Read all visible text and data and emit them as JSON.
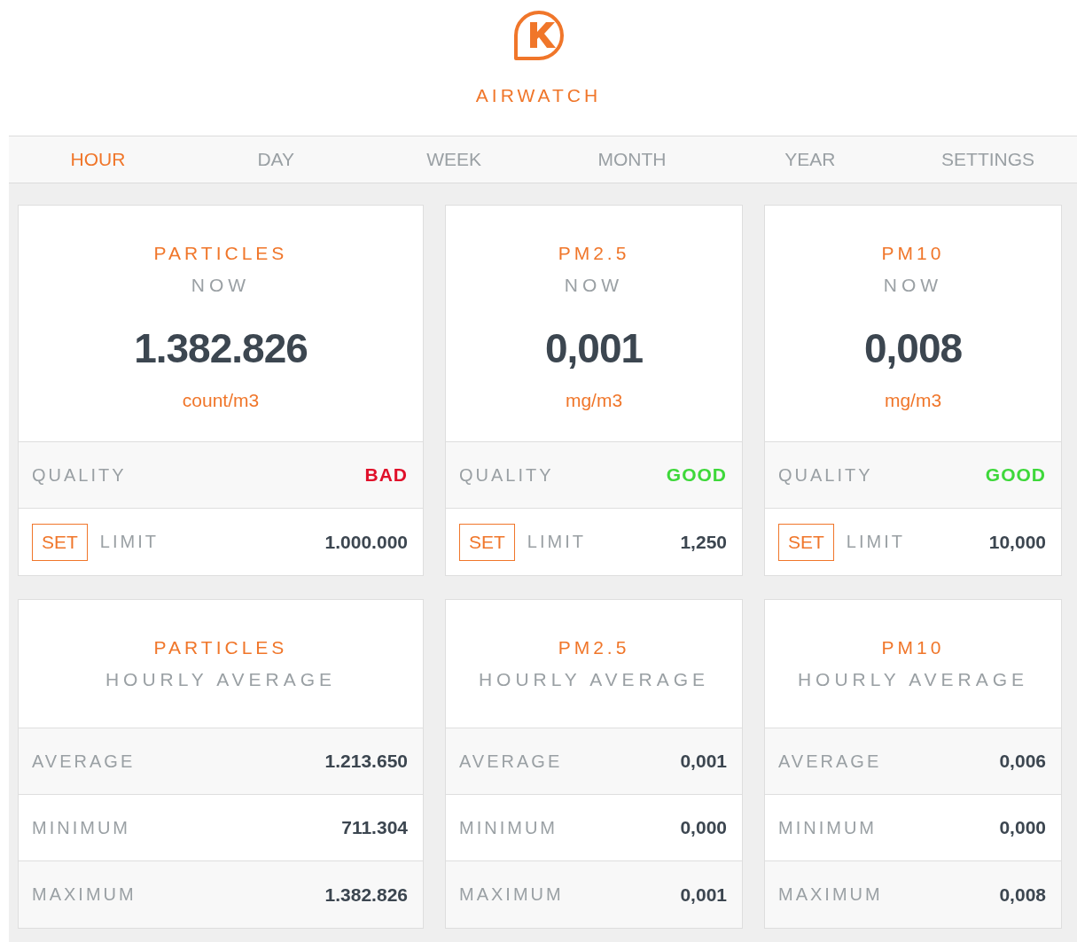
{
  "app": {
    "title": "AIRWATCH"
  },
  "tabs": [
    {
      "label": "HOUR",
      "selected": true
    },
    {
      "label": "DAY",
      "selected": false
    },
    {
      "label": "WEEK",
      "selected": false
    },
    {
      "label": "MONTH",
      "selected": false
    },
    {
      "label": "YEAR",
      "selected": false
    },
    {
      "label": "SETTINGS",
      "selected": false
    }
  ],
  "now_cards": [
    {
      "title": "PARTICLES",
      "subtitle": "NOW",
      "value": "1.382.826",
      "unit": "count/m3",
      "quality": {
        "label": "QUALITY",
        "value": "BAD",
        "color": "#e0102a"
      },
      "limit": {
        "button": "SET",
        "label": "LIMIT",
        "value": "1.000.000"
      }
    },
    {
      "title": "PM2.5",
      "subtitle": "NOW",
      "value": "0,001",
      "unit": "mg/m3",
      "quality": {
        "label": "QUALITY",
        "value": "GOOD",
        "color": "#3ed83a"
      },
      "limit": {
        "button": "SET",
        "label": "LIMIT",
        "value": "1,250"
      }
    },
    {
      "title": "PM10",
      "subtitle": "NOW",
      "value": "0,008",
      "unit": "mg/m3",
      "quality": {
        "label": "QUALITY",
        "value": "GOOD",
        "color": "#3ed83a"
      },
      "limit": {
        "button": "SET",
        "label": "LIMIT",
        "value": "10,000"
      }
    }
  ],
  "average_cards": [
    {
      "title": "PARTICLES",
      "subtitle": "HOURLY AVERAGE",
      "rows": [
        {
          "label": "AVERAGE",
          "value": "1.213.650"
        },
        {
          "label": "MINIMUM",
          "value": "711.304"
        },
        {
          "label": "MAXIMUM",
          "value": "1.382.826"
        }
      ]
    },
    {
      "title": "PM2.5",
      "subtitle": "HOURLY AVERAGE",
      "rows": [
        {
          "label": "AVERAGE",
          "value": "0,001"
        },
        {
          "label": "MINIMUM",
          "value": "0,000"
        },
        {
          "label": "MAXIMUM",
          "value": "0,001"
        }
      ]
    },
    {
      "title": "PM10",
      "subtitle": "HOURLY AVERAGE",
      "rows": [
        {
          "label": "AVERAGE",
          "value": "0,006"
        },
        {
          "label": "MINIMUM",
          "value": "0,000"
        },
        {
          "label": "MAXIMUM",
          "value": "0,008"
        }
      ]
    }
  ]
}
